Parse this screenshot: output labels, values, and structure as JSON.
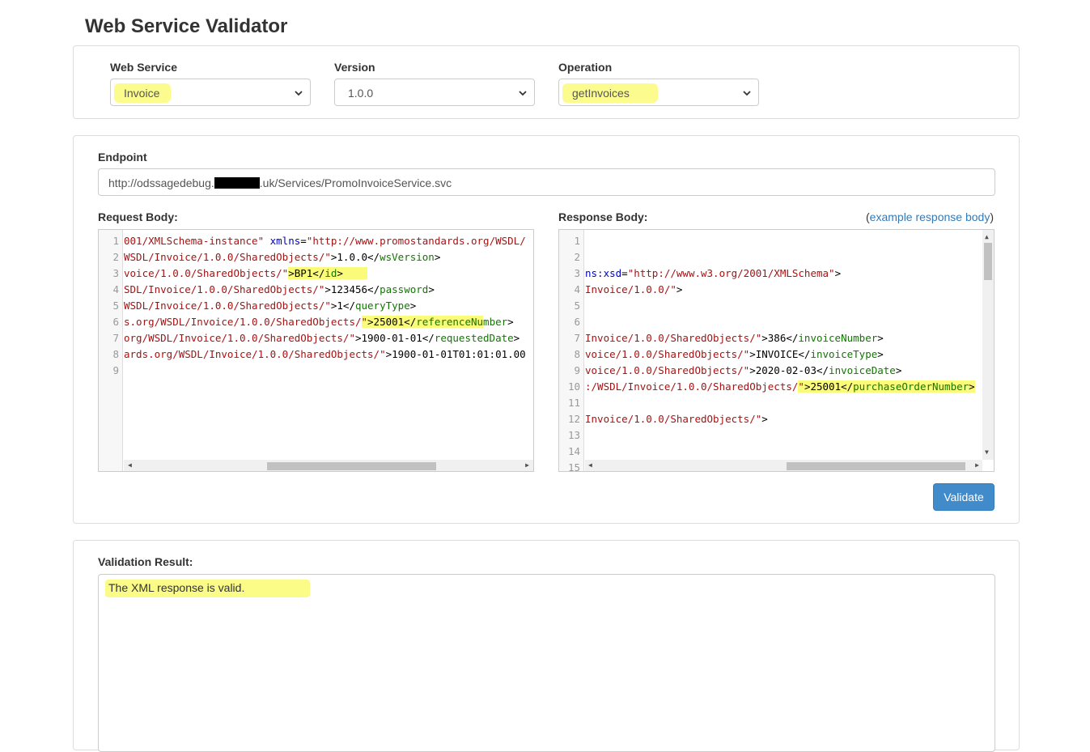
{
  "page": {
    "title": "Web Service Validator"
  },
  "selectors": {
    "web_service": {
      "label": "Web Service",
      "value": "Invoice"
    },
    "version": {
      "label": "Version",
      "value": "1.0.0"
    },
    "operation": {
      "label": "Operation",
      "value": "getInvoices"
    }
  },
  "endpoint": {
    "label": "Endpoint",
    "prefix": "http://odssagedebug.",
    "suffix": ".uk/Services/PromoInvoiceService.svc"
  },
  "request": {
    "label": "Request Body:",
    "line_numbers": [
      "1",
      "2",
      "3",
      "4",
      "5",
      "6",
      "7",
      "8",
      "9"
    ]
  },
  "response": {
    "label": "Response Body:",
    "paren_open": "(",
    "example_link": "example response body",
    "paren_close": ")",
    "line_numbers": [
      "1",
      "2",
      "3",
      "4",
      "5",
      "6",
      "7",
      "8",
      "9",
      "10",
      "11",
      "12",
      "13",
      "14",
      "15"
    ]
  },
  "actions": {
    "validate_label": "Validate"
  },
  "result": {
    "label": "Validation Result:",
    "message": "The XML response is valid."
  }
}
